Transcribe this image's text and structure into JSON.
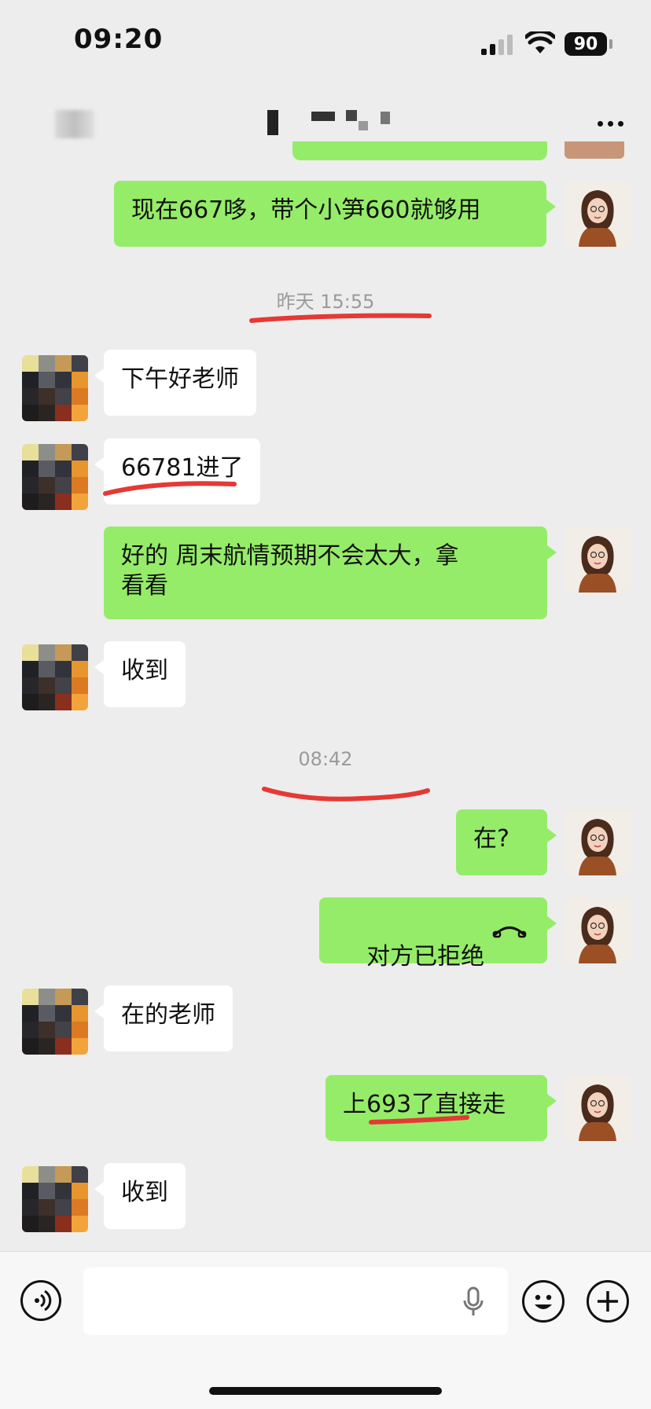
{
  "status_bar": {
    "time": "09:20",
    "battery": "90"
  },
  "header": {
    "more_icon": "more-icon"
  },
  "messages": [
    {
      "side": "out",
      "text": "现在667哆，带个小笋660就够用"
    },
    {
      "side": "in",
      "text": "下午好老师"
    },
    {
      "side": "in",
      "text": "66781进了"
    },
    {
      "side": "out",
      "text": "好的 周末航情预期不会太大，拿\n看看"
    },
    {
      "side": "in",
      "text": "收到"
    },
    {
      "side": "out",
      "text": "在?"
    },
    {
      "side": "out",
      "text": "对方已拒绝",
      "icon": "phone-hangup-icon"
    },
    {
      "side": "in",
      "text": "在的老师"
    },
    {
      "side": "out",
      "text": "上693了直接走"
    },
    {
      "side": "in",
      "text": "收到"
    }
  ],
  "timestamps": [
    "昨天 15:55",
    "08:42"
  ],
  "input": {
    "placeholder": ""
  },
  "colors": {
    "outgoing_bubble": "#95ec69",
    "incoming_bubble": "#ffffff",
    "background": "#ededed",
    "annotation": "#e53935"
  }
}
